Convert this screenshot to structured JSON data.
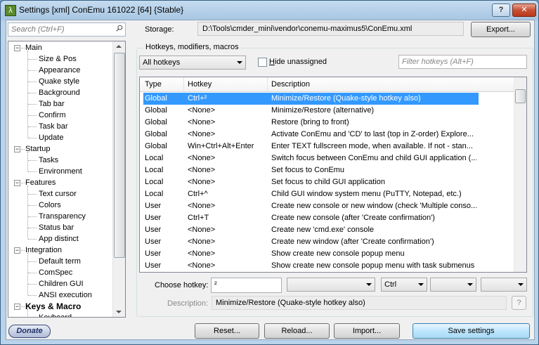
{
  "window": {
    "title": "Settings [xml] ConEmu 161022 [64] {Stable}",
    "help_label": "?",
    "close_label": "✕"
  },
  "sidebar": {
    "search_placeholder": "Search (Ctrl+F)",
    "tree": [
      {
        "label": "Main",
        "level": 0
      },
      {
        "label": "Size & Pos",
        "level": 1
      },
      {
        "label": "Appearance",
        "level": 1
      },
      {
        "label": "Quake style",
        "level": 1
      },
      {
        "label": "Background",
        "level": 1
      },
      {
        "label": "Tab bar",
        "level": 1
      },
      {
        "label": "Confirm",
        "level": 1
      },
      {
        "label": "Task bar",
        "level": 1
      },
      {
        "label": "Update",
        "level": 1
      },
      {
        "label": "Startup",
        "level": 0
      },
      {
        "label": "Tasks",
        "level": 1
      },
      {
        "label": "Environment",
        "level": 1
      },
      {
        "label": "Features",
        "level": 0
      },
      {
        "label": "Text cursor",
        "level": 1
      },
      {
        "label": "Colors",
        "level": 1
      },
      {
        "label": "Transparency",
        "level": 1
      },
      {
        "label": "Status bar",
        "level": 1
      },
      {
        "label": "App distinct",
        "level": 1
      },
      {
        "label": "Integration",
        "level": 0
      },
      {
        "label": "Default term",
        "level": 1
      },
      {
        "label": "ComSpec",
        "level": 1
      },
      {
        "label": "Children GUI",
        "level": 1
      },
      {
        "label": "ANSI execution",
        "level": 1
      },
      {
        "label": "Keys & Macro",
        "level": 0,
        "bold": true
      },
      {
        "label": "Keyboard",
        "level": 1
      }
    ]
  },
  "storage": {
    "label": "Storage:",
    "path": "D:\\Tools\\cmder_mini\\vendor\\conemu-maximus5\\ConEmu.xml",
    "export_label": "Export..."
  },
  "hotkeys": {
    "group_title": "Hotkeys, modifiers, macros",
    "filter_combo": "All hotkeys",
    "hide_unassigned_label": "Hide unassigned",
    "filter_placeholder": "Filter hotkeys (Alt+F)",
    "columns": [
      "Type",
      "Hotkey",
      "Description"
    ],
    "rows": [
      {
        "type": "Global",
        "hotkey": "Ctrl+²",
        "desc": "Minimize/Restore (Quake-style hotkey also)",
        "selected": true
      },
      {
        "type": "Global",
        "hotkey": "<None>",
        "desc": "Minimize/Restore (alternative)"
      },
      {
        "type": "Global",
        "hotkey": "<None>",
        "desc": "Restore (bring to front)"
      },
      {
        "type": "Global",
        "hotkey": "<None>",
        "desc": "Activate ConEmu and 'CD' to last (top in Z-order) Explore..."
      },
      {
        "type": "Global",
        "hotkey": "Win+Ctrl+Alt+Enter",
        "desc": "Enter TEXT fullscreen mode, when available. If not - stan..."
      },
      {
        "type": "Local",
        "hotkey": "<None>",
        "desc": "Switch focus between ConEmu and child GUI application (..."
      },
      {
        "type": "Local",
        "hotkey": "<None>",
        "desc": "Set focus to ConEmu"
      },
      {
        "type": "Local",
        "hotkey": "<None>",
        "desc": "Set focus to child GUI application"
      },
      {
        "type": "Local",
        "hotkey": "Ctrl+^",
        "desc": "Child GUI window system menu (PuTTY, Notepad, etc.)"
      },
      {
        "type": "User",
        "hotkey": "<None>",
        "desc": "Create new console or new window (check 'Multiple conso..."
      },
      {
        "type": "User",
        "hotkey": "Ctrl+T",
        "desc": "Create new console (after 'Create confirmation')"
      },
      {
        "type": "User",
        "hotkey": "<None>",
        "desc": "Create new 'cmd.exe' console"
      },
      {
        "type": "User",
        "hotkey": "<None>",
        "desc": "Create new window (after 'Create confirmation')"
      },
      {
        "type": "User",
        "hotkey": "<None>",
        "desc": "Show create new console popup menu"
      },
      {
        "type": "User",
        "hotkey": "<None>",
        "desc": "Show create new console popup menu with task submenus"
      }
    ],
    "choose_label": "Choose hotkey:",
    "choose_value": "²",
    "modifier_value": "Ctrl",
    "description_label": "Description:",
    "description_value": "Minimize/Restore (Quake-style hotkey also)",
    "description_help": "?"
  },
  "footer": {
    "donate_label": "Donate",
    "reset_label": "Reset...",
    "reload_label": "Reload...",
    "import_label": "Import...",
    "save_label": "Save settings"
  },
  "colors": {
    "selection": "#3399ff",
    "title_bar": "#b9d3ea"
  }
}
